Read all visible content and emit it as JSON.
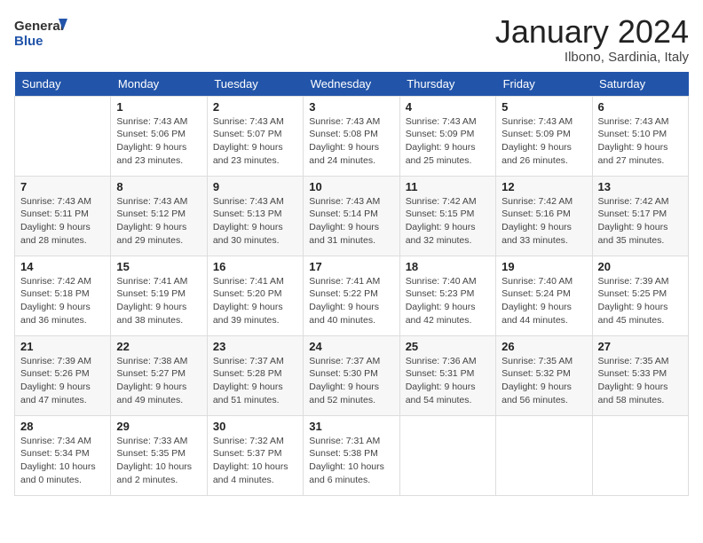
{
  "logo": {
    "general": "General",
    "blue": "Blue"
  },
  "header": {
    "month_year": "January 2024",
    "location": "Ilbono, Sardinia, Italy"
  },
  "weekdays": [
    "Sunday",
    "Monday",
    "Tuesday",
    "Wednesday",
    "Thursday",
    "Friday",
    "Saturday"
  ],
  "weeks": [
    [
      {
        "day": "",
        "info": ""
      },
      {
        "day": "1",
        "info": "Sunrise: 7:43 AM\nSunset: 5:06 PM\nDaylight: 9 hours\nand 23 minutes."
      },
      {
        "day": "2",
        "info": "Sunrise: 7:43 AM\nSunset: 5:07 PM\nDaylight: 9 hours\nand 23 minutes."
      },
      {
        "day": "3",
        "info": "Sunrise: 7:43 AM\nSunset: 5:08 PM\nDaylight: 9 hours\nand 24 minutes."
      },
      {
        "day": "4",
        "info": "Sunrise: 7:43 AM\nSunset: 5:09 PM\nDaylight: 9 hours\nand 25 minutes."
      },
      {
        "day": "5",
        "info": "Sunrise: 7:43 AM\nSunset: 5:09 PM\nDaylight: 9 hours\nand 26 minutes."
      },
      {
        "day": "6",
        "info": "Sunrise: 7:43 AM\nSunset: 5:10 PM\nDaylight: 9 hours\nand 27 minutes."
      }
    ],
    [
      {
        "day": "7",
        "info": "Sunrise: 7:43 AM\nSunset: 5:11 PM\nDaylight: 9 hours\nand 28 minutes."
      },
      {
        "day": "8",
        "info": "Sunrise: 7:43 AM\nSunset: 5:12 PM\nDaylight: 9 hours\nand 29 minutes."
      },
      {
        "day": "9",
        "info": "Sunrise: 7:43 AM\nSunset: 5:13 PM\nDaylight: 9 hours\nand 30 minutes."
      },
      {
        "day": "10",
        "info": "Sunrise: 7:43 AM\nSunset: 5:14 PM\nDaylight: 9 hours\nand 31 minutes."
      },
      {
        "day": "11",
        "info": "Sunrise: 7:42 AM\nSunset: 5:15 PM\nDaylight: 9 hours\nand 32 minutes."
      },
      {
        "day": "12",
        "info": "Sunrise: 7:42 AM\nSunset: 5:16 PM\nDaylight: 9 hours\nand 33 minutes."
      },
      {
        "day": "13",
        "info": "Sunrise: 7:42 AM\nSunset: 5:17 PM\nDaylight: 9 hours\nand 35 minutes."
      }
    ],
    [
      {
        "day": "14",
        "info": "Sunrise: 7:42 AM\nSunset: 5:18 PM\nDaylight: 9 hours\nand 36 minutes."
      },
      {
        "day": "15",
        "info": "Sunrise: 7:41 AM\nSunset: 5:19 PM\nDaylight: 9 hours\nand 38 minutes."
      },
      {
        "day": "16",
        "info": "Sunrise: 7:41 AM\nSunset: 5:20 PM\nDaylight: 9 hours\nand 39 minutes."
      },
      {
        "day": "17",
        "info": "Sunrise: 7:41 AM\nSunset: 5:22 PM\nDaylight: 9 hours\nand 40 minutes."
      },
      {
        "day": "18",
        "info": "Sunrise: 7:40 AM\nSunset: 5:23 PM\nDaylight: 9 hours\nand 42 minutes."
      },
      {
        "day": "19",
        "info": "Sunrise: 7:40 AM\nSunset: 5:24 PM\nDaylight: 9 hours\nand 44 minutes."
      },
      {
        "day": "20",
        "info": "Sunrise: 7:39 AM\nSunset: 5:25 PM\nDaylight: 9 hours\nand 45 minutes."
      }
    ],
    [
      {
        "day": "21",
        "info": "Sunrise: 7:39 AM\nSunset: 5:26 PM\nDaylight: 9 hours\nand 47 minutes."
      },
      {
        "day": "22",
        "info": "Sunrise: 7:38 AM\nSunset: 5:27 PM\nDaylight: 9 hours\nand 49 minutes."
      },
      {
        "day": "23",
        "info": "Sunrise: 7:37 AM\nSunset: 5:28 PM\nDaylight: 9 hours\nand 51 minutes."
      },
      {
        "day": "24",
        "info": "Sunrise: 7:37 AM\nSunset: 5:30 PM\nDaylight: 9 hours\nand 52 minutes."
      },
      {
        "day": "25",
        "info": "Sunrise: 7:36 AM\nSunset: 5:31 PM\nDaylight: 9 hours\nand 54 minutes."
      },
      {
        "day": "26",
        "info": "Sunrise: 7:35 AM\nSunset: 5:32 PM\nDaylight: 9 hours\nand 56 minutes."
      },
      {
        "day": "27",
        "info": "Sunrise: 7:35 AM\nSunset: 5:33 PM\nDaylight: 9 hours\nand 58 minutes."
      }
    ],
    [
      {
        "day": "28",
        "info": "Sunrise: 7:34 AM\nSunset: 5:34 PM\nDaylight: 10 hours\nand 0 minutes."
      },
      {
        "day": "29",
        "info": "Sunrise: 7:33 AM\nSunset: 5:35 PM\nDaylight: 10 hours\nand 2 minutes."
      },
      {
        "day": "30",
        "info": "Sunrise: 7:32 AM\nSunset: 5:37 PM\nDaylight: 10 hours\nand 4 minutes."
      },
      {
        "day": "31",
        "info": "Sunrise: 7:31 AM\nSunset: 5:38 PM\nDaylight: 10 hours\nand 6 minutes."
      },
      {
        "day": "",
        "info": ""
      },
      {
        "day": "",
        "info": ""
      },
      {
        "day": "",
        "info": ""
      }
    ]
  ]
}
